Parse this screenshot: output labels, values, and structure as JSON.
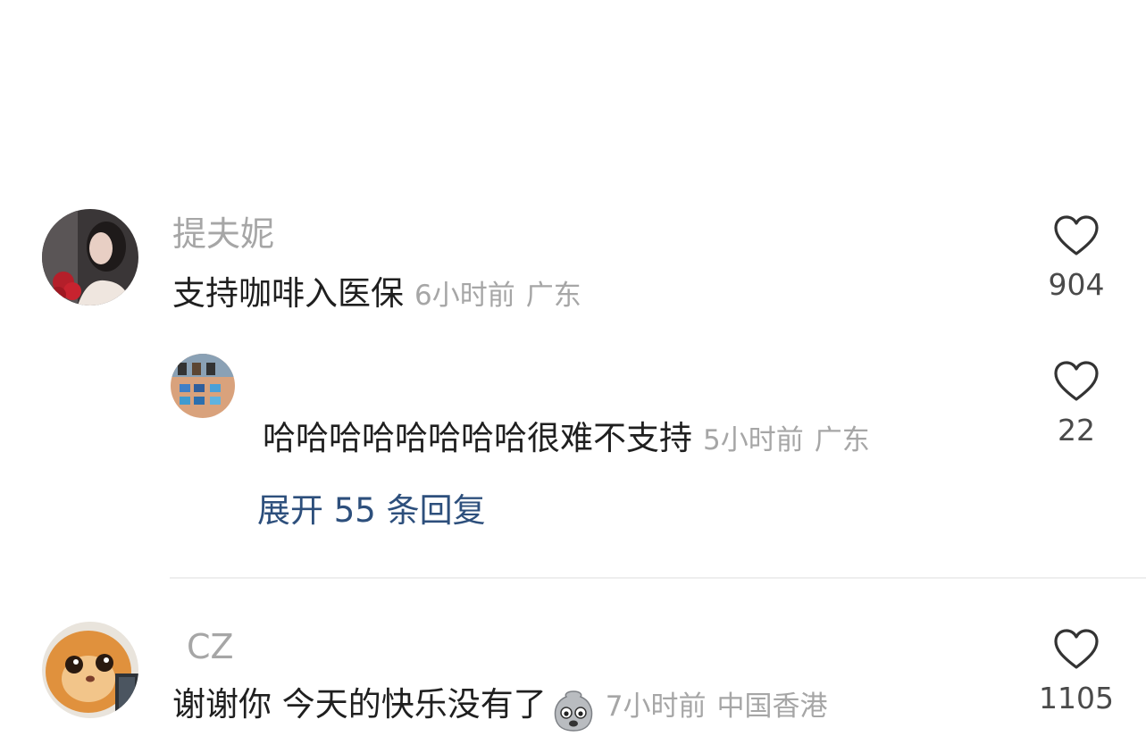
{
  "comments": [
    {
      "username": "提夫妮",
      "text": "支持咖啡入医保",
      "time": "6小时前",
      "location": "广东",
      "likes": "904",
      "reply": {
        "username": "",
        "text": "哈哈哈哈哈哈哈哈很难不支持",
        "time": "5小时前",
        "location": "广东",
        "likes": "22"
      },
      "expand_label": "展开 55 条回复"
    },
    {
      "username": "CZ",
      "text": "谢谢你 今天的快乐没有了",
      "emoji": "crying-face-emoji",
      "time": "7小时前",
      "location": "中国香港",
      "likes": "1105"
    }
  ],
  "icons": {
    "like": "heart-outline-icon"
  },
  "colors": {
    "username": "#a6a6a6",
    "text": "#1f1f1f",
    "expand_link": "#2d4f7c",
    "divider": "#eeeeee"
  }
}
